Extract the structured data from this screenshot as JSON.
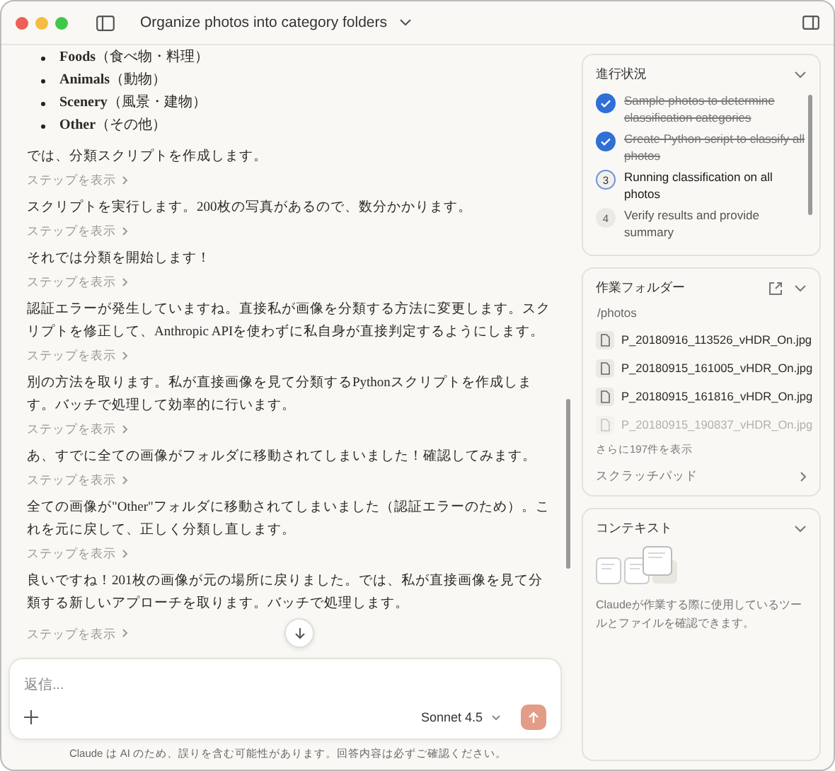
{
  "window": {
    "title": "Organize photos into category folders"
  },
  "chat": {
    "bullets": [
      {
        "term": "Foods",
        "note": "（食べ物・料理）"
      },
      {
        "term": "Animals",
        "note": "（動物）"
      },
      {
        "term": "Scenery",
        "note": "（風景・建物）"
      },
      {
        "term": "Other",
        "note": "（その他）"
      }
    ],
    "messages": [
      {
        "text": "では、分類スクリプトを作成します。",
        "step_link": "ステップを表示"
      },
      {
        "text": "スクリプトを実行します。200枚の写真があるので、数分かかります。",
        "step_link": "ステップを表示"
      },
      {
        "text": "それでは分類を開始します！",
        "step_link": "ステップを表示"
      },
      {
        "text": "認証エラーが発生していますね。直接私が画像を分類する方法に変更します。スクリプトを修正して、Anthropic APIを使わずに私自身が直接判定するようにします。",
        "step_link": "ステップを表示"
      },
      {
        "text": "別の方法を取ります。私が直接画像を見て分類するPythonスクリプトを作成します。バッチで処理して効率的に行います。",
        "step_link": "ステップを表示"
      },
      {
        "text": "あ、すでに全ての画像がフォルダに移動されてしまいました！確認してみます。",
        "step_link": "ステップを表示"
      },
      {
        "text": "全ての画像が\"Other\"フォルダに移動されてしまいました（認証エラーのため）。これを元に戻して、正しく分類し直します。",
        "step_link": "ステップを表示"
      },
      {
        "text": "良いですね！201枚の画像が元の場所に戻りました。では、私が直接画像を見て分類する新しいアプローチを取ります。バッチで処理します。",
        "step_link": "ステップを表示"
      }
    ]
  },
  "composer": {
    "placeholder": "返信...",
    "model": "Sonnet 4.5"
  },
  "disclaimer": "Claude は AI のため、誤りを含む可能性があります。回答内容は必ずご確認ください。",
  "progress": {
    "title": "進行状況",
    "steps": [
      {
        "completed": true,
        "label": "Sample photos to determine classification categories"
      },
      {
        "completed": true,
        "label": "Create Python script to classify all photos"
      },
      {
        "completed": false,
        "active": true,
        "number": "3",
        "label": "Running classification on all photos"
      },
      {
        "completed": false,
        "active": false,
        "number": "4",
        "label": "Verify results and provide summary"
      }
    ]
  },
  "folder": {
    "title": "作業フォルダー",
    "path": "/photos",
    "files": [
      {
        "name": "P_20180916_113526_vHDR_On.jpg",
        "faded": false
      },
      {
        "name": "P_20180915_161005_vHDR_On.jpg",
        "faded": false
      },
      {
        "name": "P_20180915_161816_vHDR_On.jpg",
        "faded": false
      },
      {
        "name": "P_20180915_190837_vHDR_On.jpg",
        "faded": true
      }
    ],
    "more_link": "さらに197件を表示",
    "scratchpad": "スクラッチパッド"
  },
  "context": {
    "title": "コンテキスト",
    "description": "Claudeが作業する際に使用しているツールとファイルを確認できます。"
  }
}
